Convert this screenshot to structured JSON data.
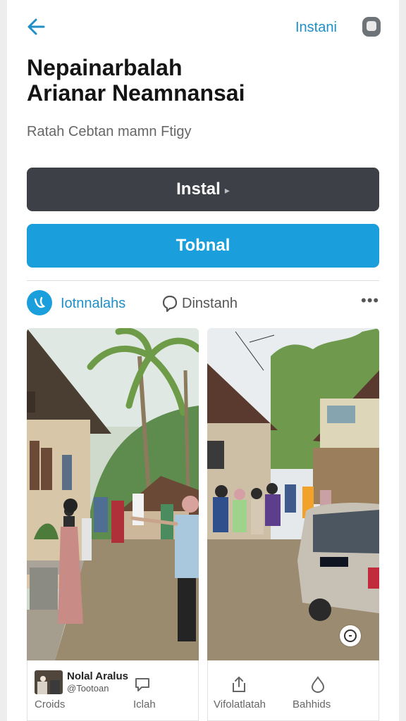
{
  "header": {
    "back_icon": "arrow-left-icon",
    "link_label": "Instani",
    "profile_icon": "profile-icon"
  },
  "title": {
    "line1": "Nepainarbalah",
    "line2": "Arianar Neamnansai"
  },
  "subtitle": "Ratah Cebtan mamn Ftigy",
  "buttons": {
    "primary_label": "Instal",
    "secondary_label": "Tobnal"
  },
  "social": {
    "author_name": "Iotnnalahs",
    "comment_label": "Dinstanh",
    "more_label": "•••"
  },
  "cards": [
    {
      "name": "Nolal Aralus",
      "handle": "@Tootoan",
      "bottom_left": "Croids",
      "bottom_right": "Iclah"
    },
    {
      "left_label": "Vifolatlatah",
      "right_label": "Bahhids"
    }
  ],
  "colors": {
    "accent": "#1b9edc",
    "dark_button": "#3d4147",
    "link": "#1f8fc7"
  }
}
